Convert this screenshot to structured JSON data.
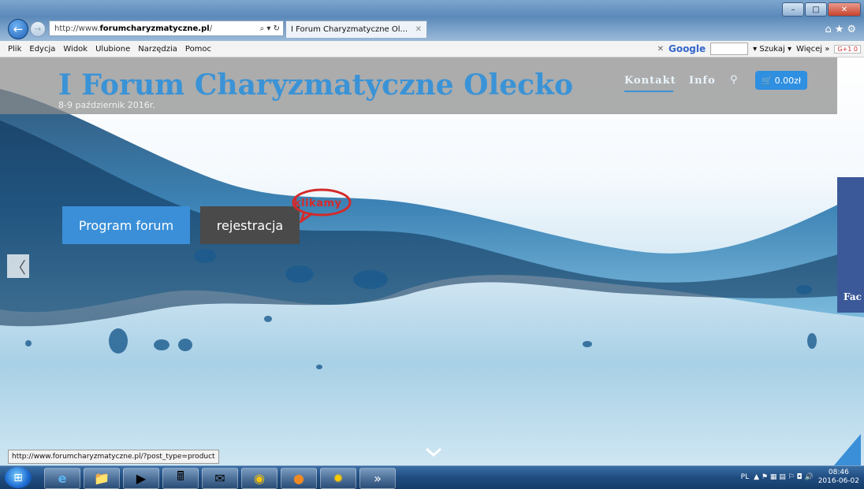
{
  "browser": {
    "url_prefix": "http://www.",
    "url_domain": "forumcharyzmatyczne.pl",
    "url_suffix": "/",
    "tab_title": "I Forum Charyzmatyczne Ol...",
    "menu": [
      "Plik",
      "Edycja",
      "Widok",
      "Ulubione",
      "Narzędzia",
      "Pomoc"
    ],
    "google_logo": "Google",
    "search_label": "Szukaj",
    "more_label": "Więcej",
    "gplus_label": "G+1",
    "gplus_count": "0"
  },
  "site": {
    "title": "I Forum Charyzmatyczne Olecko",
    "date": "8-9 październik 2016r.",
    "nav_kontakt": "Kontakt",
    "nav_info": "Info",
    "cart_value": "0.00zł",
    "program_button": "Program forum",
    "register_button": "rejestracja",
    "klikamy": "klikamy",
    "facebook_tab": "Fac",
    "status_url": "http://www.forumcharyzmatyczne.pl/?post_type=product"
  },
  "taskbar": {
    "lang": "PL",
    "time": "08:46",
    "date": "2016-06-02"
  },
  "colors": {
    "accent": "#3a93d6",
    "button_dark": "#4a4a4a",
    "facebook": "#3b5998",
    "klikamy_red": "#d42a2a"
  }
}
